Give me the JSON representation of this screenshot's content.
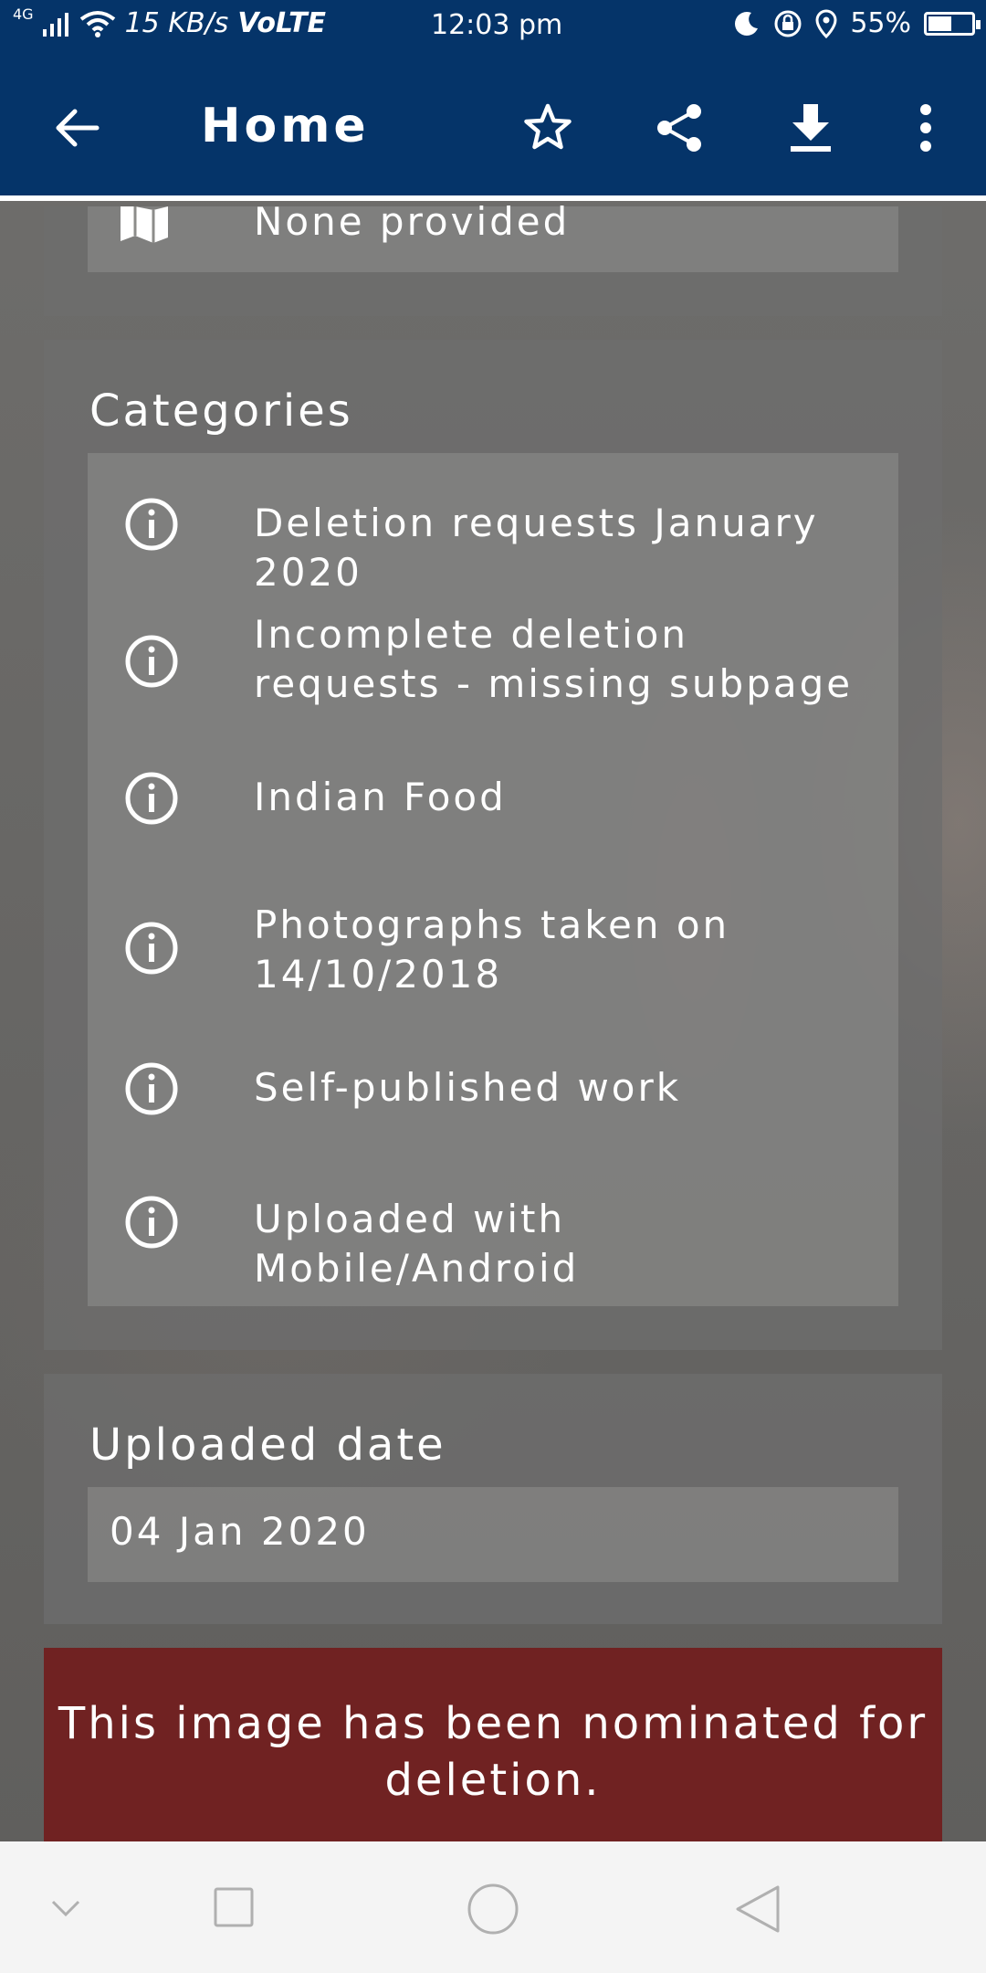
{
  "status_bar": {
    "network": "4G",
    "speed": "15 KB/s",
    "volte": "VoLTE",
    "time": "12:03 pm",
    "battery": "55%",
    "battery_level": 0.55
  },
  "app_bar": {
    "title": "Home",
    "icons": [
      "back-arrow-icon",
      "star-icon",
      "share-icon",
      "download-icon",
      "more-vert-icon"
    ]
  },
  "license": {
    "value": "None provided"
  },
  "categories": {
    "title": "Categories",
    "items": [
      {
        "label": "Deletion requests January 2020"
      },
      {
        "label": "Incomplete deletion requests - missing subpage"
      },
      {
        "label": "Indian Food"
      },
      {
        "label": "Photographs taken on 14/10/2018"
      },
      {
        "label": "Self-published work"
      },
      {
        "label": "Uploaded with Mobile/Android"
      }
    ]
  },
  "uploaded": {
    "title": "Uploaded date",
    "value": "04 Jan 2020"
  },
  "deletion_notice": "This image has been nominated for deletion.",
  "colors": {
    "app_bar": "#053469",
    "deletion_banner": "#702222",
    "card": "#6e6e6e"
  },
  "nav_bar": {
    "icons": [
      "chevron-down-icon",
      "recents-square-icon",
      "home-circle-icon",
      "back-triangle-icon"
    ]
  }
}
